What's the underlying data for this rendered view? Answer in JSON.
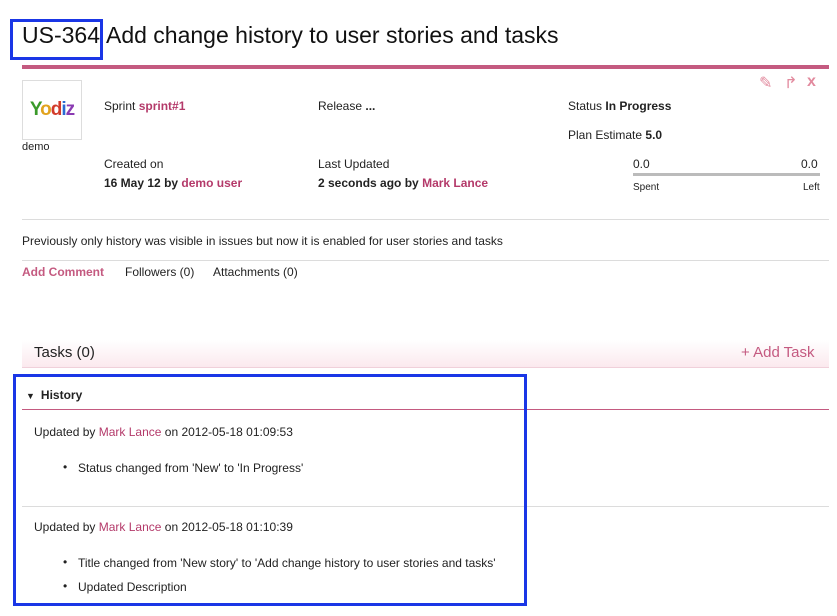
{
  "story": {
    "id": "US-364",
    "title": "Add change history to user stories and tasks"
  },
  "toolbar": {
    "edit_icon": "pencil-icon",
    "move_icon": "arrow-icon",
    "delete_icon": "close-icon",
    "edit_glyph": "✎",
    "move_glyph": "↱",
    "delete_glyph": "x"
  },
  "project": {
    "logo_text": [
      "Y",
      "o",
      "d",
      "i",
      "z"
    ],
    "name": "demo"
  },
  "details": {
    "sprint_label": "Sprint",
    "sprint_value": "sprint#1",
    "release_label": "Release",
    "release_value": "...",
    "status_label": "Status",
    "status_value": "In Progress",
    "plan_label": "Plan Estimate",
    "plan_value": "5.0",
    "created_label": "Created on",
    "created_date": "16 May 12",
    "created_by_word": "by",
    "created_user": "demo user",
    "updated_label": "Last Updated",
    "updated_when": "2 seconds ago",
    "updated_by_word": "by",
    "updated_user": "Mark Lance",
    "spent_value": "0.0",
    "left_value": "0.0",
    "spent_label": "Spent",
    "left_label": "Left"
  },
  "description": "Previously only history was visible in issues but now it is enabled for user stories and tasks",
  "tabs": {
    "comment": "Add Comment",
    "followers": "Followers (0)",
    "attachments": "Attachments (0)"
  },
  "tasks": {
    "title": "Tasks (0)",
    "add_label": "+ Add Task"
  },
  "history": {
    "title": "History",
    "entries": [
      {
        "prefix": "Updated by",
        "user": "Mark Lance",
        "suffix": "on 2012-05-18 01:09:53",
        "changes": [
          "Status changed from 'New' to 'In Progress'"
        ]
      },
      {
        "prefix": "Updated by",
        "user": "Mark Lance",
        "suffix": "on 2012-05-18 01:10:39",
        "changes": [
          "Title changed from 'New story' to 'Add change history to user stories and tasks'",
          "Updated Description"
        ]
      }
    ]
  },
  "colors": {
    "accent": "#c45a80",
    "link": "#b43a6a",
    "highlight": "#1a36e6"
  }
}
